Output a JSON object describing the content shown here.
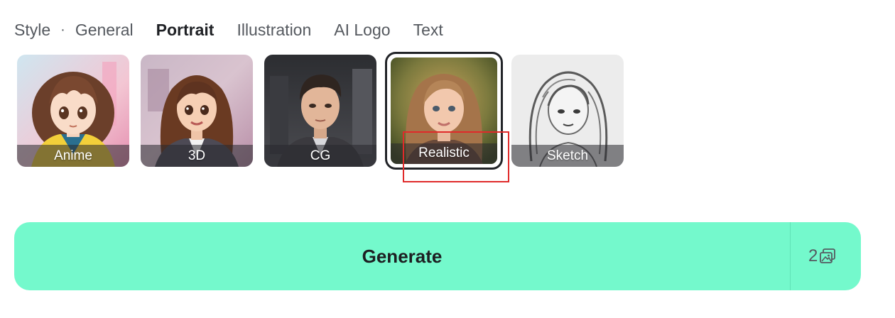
{
  "tabs": {
    "prefix": "Style",
    "separator": "·",
    "items": [
      "General",
      "Portrait",
      "Illustration",
      "AI Logo",
      "Text"
    ],
    "active": "Portrait"
  },
  "styles": [
    {
      "label": "Anime",
      "icon": "anime-portrait-thumbnail"
    },
    {
      "label": "3D",
      "icon": "3d-portrait-thumbnail"
    },
    {
      "label": "CG",
      "icon": "cg-portrait-thumbnail"
    },
    {
      "label": "Realistic",
      "icon": "realistic-portrait-thumbnail",
      "selected": true
    },
    {
      "label": "Sketch",
      "icon": "sketch-portrait-thumbnail"
    }
  ],
  "generate": {
    "label": "Generate",
    "count": "2",
    "icon": "images-icon",
    "color": "#74f9cc"
  },
  "highlight_color": "#e02a2a"
}
